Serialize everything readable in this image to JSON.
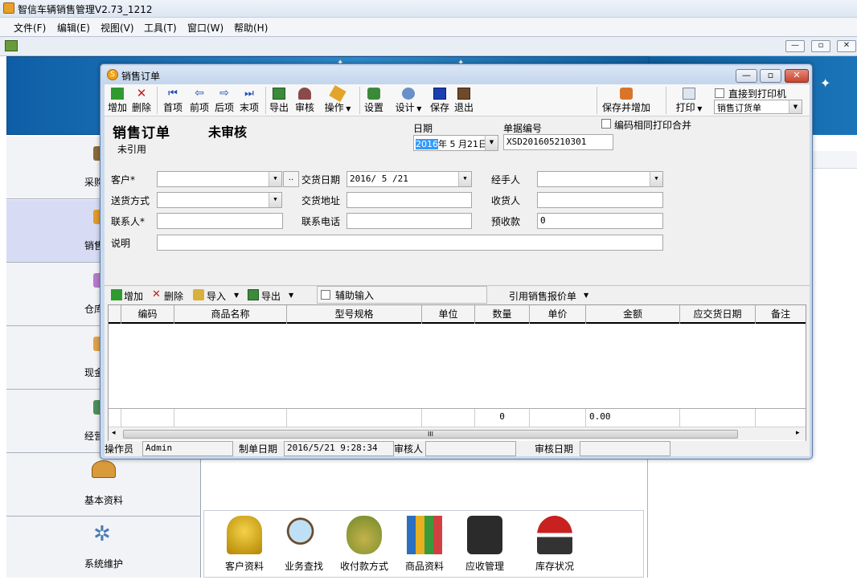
{
  "app": {
    "title": "智信车辆销售管理V2.73_1212"
  },
  "menu": [
    "文件(F)",
    "编辑(E)",
    "视图(V)",
    "工具(T)",
    "窗口(W)",
    "帮助(H)"
  ],
  "mdi_buttons": [
    "—",
    "▫",
    "✕"
  ],
  "leftnav": {
    "items": [
      {
        "label": "采购"
      },
      {
        "label": "销售"
      },
      {
        "label": "仓库"
      },
      {
        "label": "现金"
      },
      {
        "label": "经营"
      },
      {
        "label": "基本资料"
      },
      {
        "label": "系统维护"
      }
    ]
  },
  "shortcuts": [
    {
      "label": "客户资料",
      "icon": "customer-icon"
    },
    {
      "label": "业务查找",
      "icon": "search-icon"
    },
    {
      "label": "收付款方式",
      "icon": "money-bag-icon"
    },
    {
      "label": "商品资料",
      "icon": "books-icon"
    },
    {
      "label": "应收管理",
      "icon": "calculator-icon"
    },
    {
      "label": "库存状况",
      "icon": "warehouse-icon"
    }
  ],
  "dialog": {
    "title": "销售订单",
    "toolbar": {
      "add": "增加",
      "delete": "删除",
      "first": "首项",
      "prev": "前项",
      "next": "后项",
      "last": "末项",
      "export": "导出",
      "audit": "审核",
      "operate": "操作",
      "settings": "设置",
      "design": "设计",
      "save": "保存",
      "exit": "退出",
      "save_add": "保存并增加",
      "print": "打印",
      "direct_print": "直接到打印机",
      "template": "销售订货单"
    },
    "header": {
      "doc_title": "销售订单",
      "status": "未审核",
      "ref_status": "未引用",
      "date_label": "日期",
      "date_year": "2016",
      "date_rest": "年 5 月21日",
      "docno_label": "单据编号",
      "docno": "XSD201605210301",
      "merge_print": "编码相同打印合并"
    },
    "form": {
      "customer_label": "客户*",
      "customer_value": "",
      "delivery_date_label": "交货日期",
      "delivery_date": "2016/ 5 /21",
      "handler_label": "经手人",
      "handler_value": "",
      "ship_label": "送货方式",
      "ship_value": "",
      "address_label": "交货地址",
      "address_value": "",
      "receiver_label": "收货人",
      "receiver_value": "",
      "contact_label": "联系人*",
      "contact_value": "",
      "phone_label": "联系电话",
      "phone_value": "",
      "prepay_label": "预收款",
      "prepay_value": "0",
      "note_label": "说明",
      "note_value": "",
      "browse": "‥"
    },
    "grid_toolbar": {
      "add": "增加",
      "delete": "删除",
      "import": "导入",
      "export": "导出",
      "assist": "辅助输入",
      "quote": "引用销售报价单"
    },
    "grid": {
      "columns": [
        "编码",
        "商品名称",
        "型号规格",
        "单位",
        "数量",
        "单价",
        "金额",
        "应交货日期",
        "备注"
      ],
      "totals": {
        "qty": "0",
        "amount": "0.00"
      },
      "scroll_mark": "III"
    },
    "footer": {
      "operator_label": "操作员",
      "operator": "Admin",
      "made_date_label": "制单日期",
      "made_date": "2016/5/21 9:28:34",
      "auditor_label": "审核人",
      "auditor": "",
      "audit_date_label": "审核日期",
      "audit_date": ""
    }
  }
}
